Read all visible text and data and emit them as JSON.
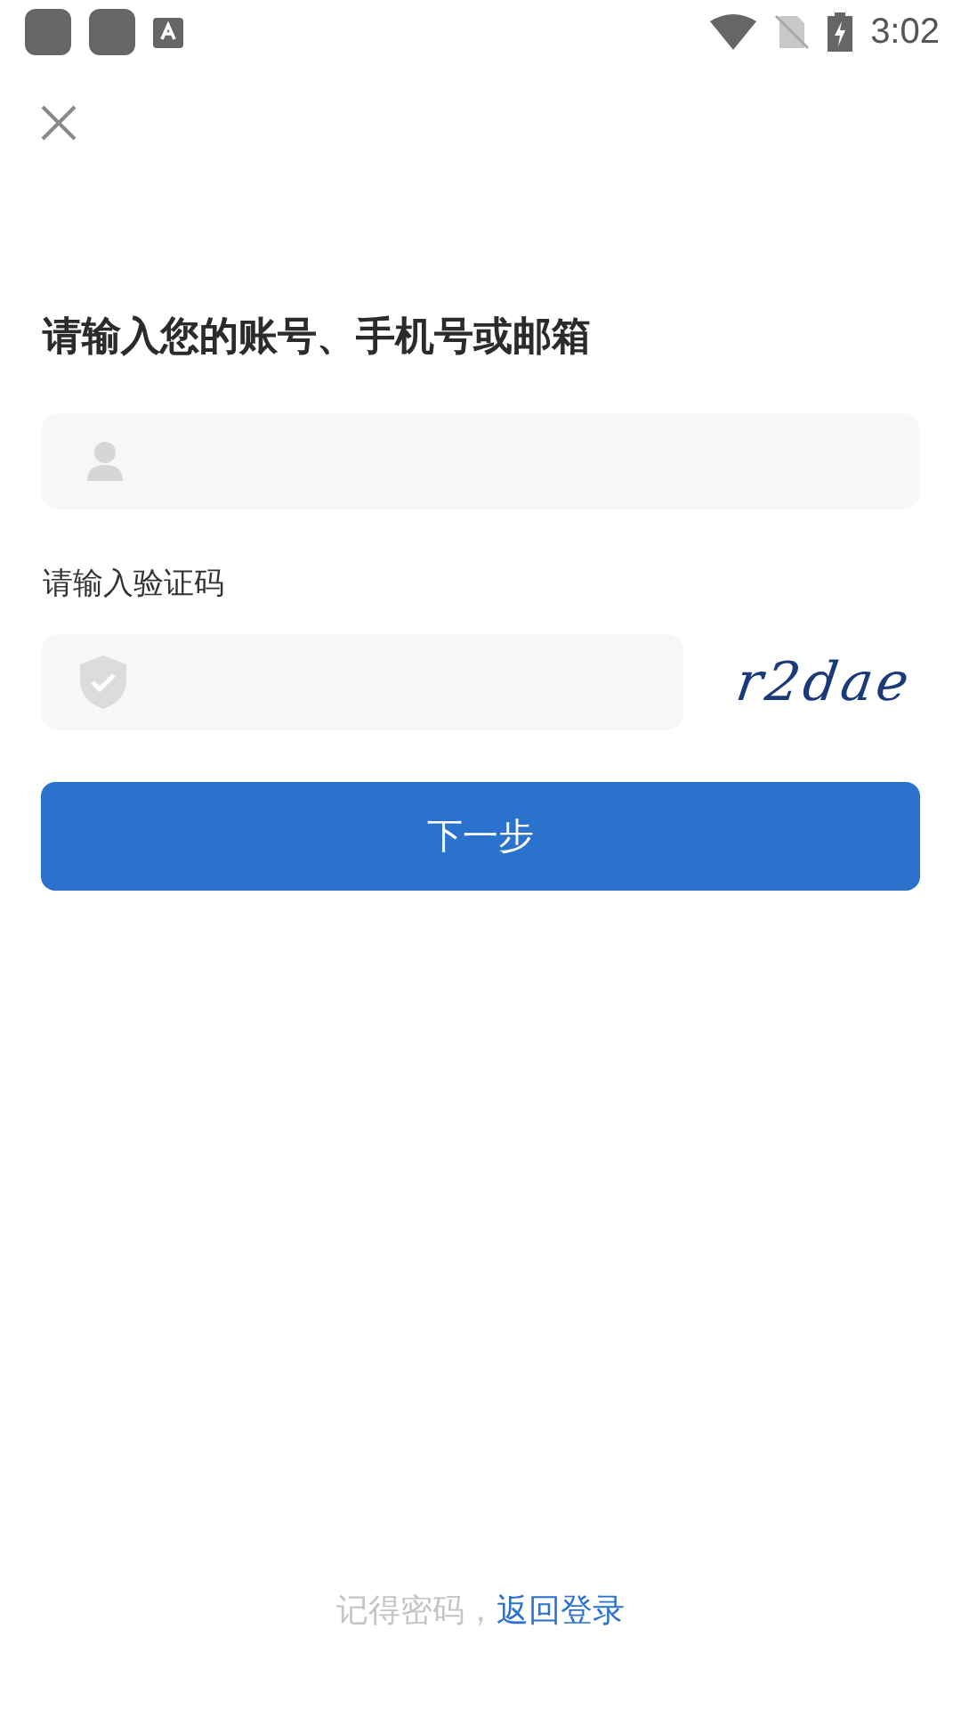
{
  "status_bar": {
    "time": "3:02"
  },
  "title": "请输入您的账号、手机号或邮箱",
  "captcha": {
    "label": "请输入验证码",
    "code": "r2dae"
  },
  "next_button": "下一步",
  "footer": {
    "text": "记得密码，",
    "link": "返回登录"
  }
}
